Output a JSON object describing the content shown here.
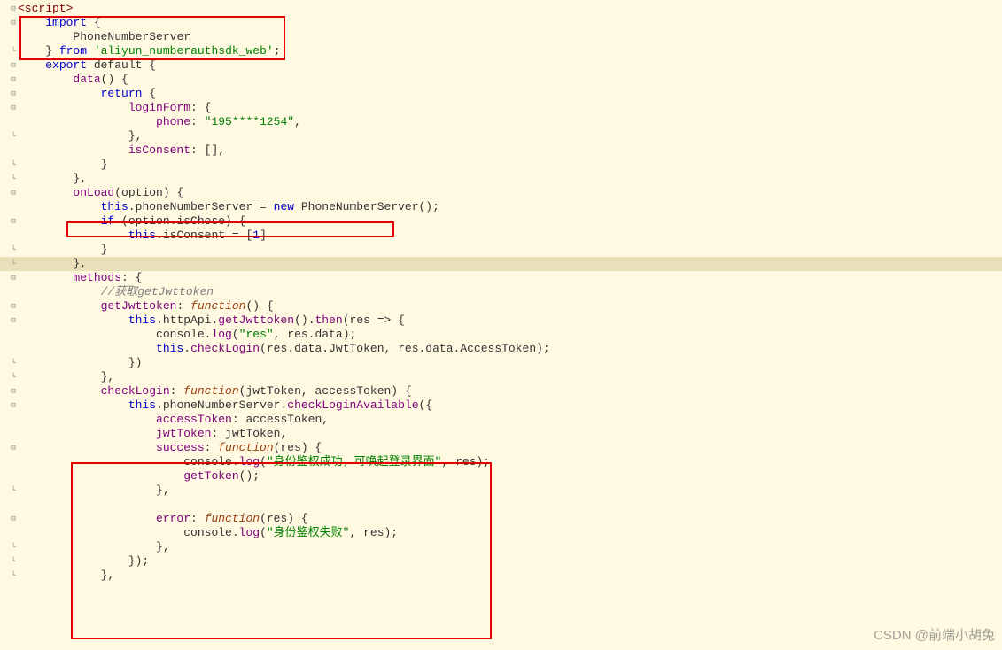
{
  "watermark": "CSDN @前端小胡兔",
  "code": {
    "l1": "<script>",
    "l2a": "import",
    "l2b": " {",
    "l3": "PhoneNumberServer",
    "l4a": "} ",
    "l4b": "from",
    "l4c": " 'aliyun_numberauthsdk_web'",
    "l4d": ";",
    "l5a": "export",
    "l5b": " default {",
    "l6a": "data",
    "l6b": "() {",
    "l7a": "return",
    "l7b": " {",
    "l8a": "loginForm",
    "l8b": ": {",
    "l9a": "phone",
    "l9b": ": ",
    "l9c": "\"195****1254\"",
    "l9d": ",",
    "l10": "},",
    "l11a": "isConsent",
    "l11b": ": [],",
    "l12": "}",
    "l13": "},",
    "l14a": "onLoad",
    "l14b": "(option) {",
    "l15a": "this",
    "l15b": ".phoneNumberServer = ",
    "l15c": "new",
    "l15d": " PhoneNumberServer();",
    "l16a": "if",
    "l16b": " (option.isChose) {",
    "l17a": "this",
    "l17b": ".isConsent = [",
    "l17c": "1",
    "l17d": "]",
    "l18": "}",
    "l19": "},",
    "l20a": "methods",
    "l20b": ": {",
    "l21": "//获取getJwttoken",
    "l22a": "getJwttoken",
    "l22b": ": ",
    "l22c": "function",
    "l22d": "() {",
    "l23a": "this",
    "l23b": ".httpApi.",
    "l23c": "getJwttoken",
    "l23d": "().",
    "l23e": "then",
    "l23f": "(res => {",
    "l24a": "console.",
    "l24b": "log",
    "l24c": "(",
    "l24d": "\"res\"",
    "l24e": ", res.data);",
    "l25a": "this",
    "l25b": ".",
    "l25c": "checkLogin",
    "l25d": "(res.data.JwtToken, res.data.AccessToken);",
    "l26": "})",
    "l27": "},",
    "l28a": "checkLogin",
    "l28b": ": ",
    "l28c": "function",
    "l28d": "(jwtToken, accessToken) {",
    "l29a": "this",
    "l29b": ".phoneNumberServer.",
    "l29c": "checkLoginAvailable",
    "l29d": "({",
    "l30a": "accessToken",
    "l30b": ": accessToken,",
    "l31a": "jwtToken",
    "l31b": ": jwtToken,",
    "l32a": "success",
    "l32b": ": ",
    "l32c": "function",
    "l32d": "(res) {",
    "l33a": "console.",
    "l33b": "log",
    "l33c": "(",
    "l33d": "\"身份鉴权成功，可唤起登录界面\"",
    "l33e": ", res);",
    "l34a": "getToken",
    "l34b": "();",
    "l35": "},",
    "l36": "",
    "l37a": "error",
    "l37b": ": ",
    "l37c": "function",
    "l37d": "(res) {",
    "l38a": "console.",
    "l38b": "log",
    "l38c": "(",
    "l38d": "\"身份鉴权失败\"",
    "l38e": ", res);",
    "l39": "},",
    "l40": "});",
    "l41": "},"
  },
  "fold_minus": "⊟",
  "fold_plus": "⊞",
  "fold_end": "└"
}
